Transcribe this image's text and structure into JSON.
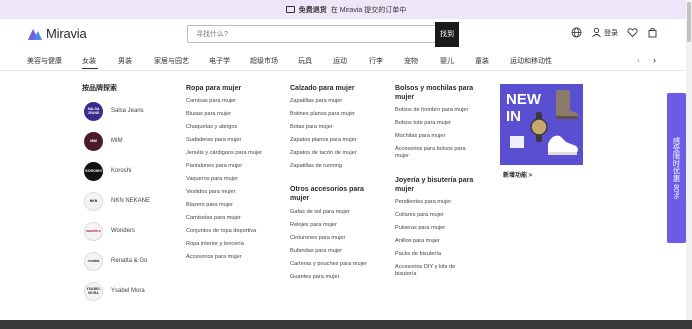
{
  "promo_bar": {
    "highlight": "免费退货",
    "text": "在 Miravia 提交的订单中"
  },
  "header": {
    "logo_text": "Miravia",
    "search_placeholder": "寻找什么?",
    "search_button": "找到",
    "login_label": "登录"
  },
  "nav": {
    "items": [
      "美容与健康",
      "女装",
      "男装",
      "家居与园艺",
      "电子学",
      "超级市场",
      "玩具",
      "运动",
      "行李",
      "宠物",
      "婴儿",
      "童装",
      "运动和移动性"
    ],
    "active": "女装"
  },
  "brands": {
    "title": "按品牌探索",
    "items": [
      {
        "name": "Salsa Jeans",
        "logo": "SALSA JEANS"
      },
      {
        "name": "MIM",
        "logo": "MIM"
      },
      {
        "name": "Koroshi",
        "logo": "KOROSHI"
      },
      {
        "name": "NKN NEKANE",
        "logo": "NKN"
      },
      {
        "name": "Wonders",
        "logo": "wonders"
      },
      {
        "name": "Renatta & Go",
        "logo": "renatta"
      },
      {
        "name": "Ysabel Mora",
        "logo": "YSABEL MORA"
      }
    ]
  },
  "columns": {
    "ropa": {
      "title": "Ropa para mujer",
      "links": [
        "Camisas para mujer",
        "Blusas para mujer",
        "Chaquetas y abrigos",
        "Sudaderas para mujer",
        "Jerséis y cárdigans para mujer",
        "Pantalones para mujer",
        "Vaqueros para mujer",
        "Vestidos para mujer",
        "Blazers para mujer",
        "Camisetas para mujer",
        "Conjuntos de ropa deportiva",
        "Ropa interior y lencería",
        "Accesorios para mujer"
      ]
    },
    "calzado": {
      "title": "Calzado para mujer",
      "links": [
        "Zapatillas para mujer",
        "Botines planos para mujer",
        "Botas para mujer",
        "Zapatos planos para mujer",
        "Zapatos de tacón de mujer",
        "Zapatillas de running"
      ]
    },
    "otros": {
      "title": "Otros accesorios para mujer",
      "links": [
        "Gafas de sol para mujer",
        "Relojes para mujer",
        "Cinturones para mujer",
        "Bufandas para mujer",
        "Carteras y pouches para mujer",
        "Guantes para mujer"
      ]
    },
    "bolsos": {
      "title": "Bolsos y mochilas para mujer",
      "links": [
        "Bolsos de hombro para mujer",
        "Bolsos tote para mujer",
        "Mochilas para mujer",
        "Accesorios para bolsos para mujer"
      ]
    },
    "joyeria": {
      "title": "Joyería y bisutería para mujer",
      "links": [
        "Pendientes para mujer",
        "Collares para mujer",
        "Pulseras para mujer",
        "Anillos para mujer",
        "Packs de bisutería",
        "Accesorios DIY y kits de bisutería"
      ]
    }
  },
  "promo_card": {
    "badge_line1": "NEW",
    "badge_line2": "IN",
    "caption": "新增功能 >"
  },
  "side_tab": {
    "text": "感受限时优惠 80%"
  },
  "colors": {
    "accent": "#6b5ce7",
    "promo_bg": "#ece6f8"
  }
}
